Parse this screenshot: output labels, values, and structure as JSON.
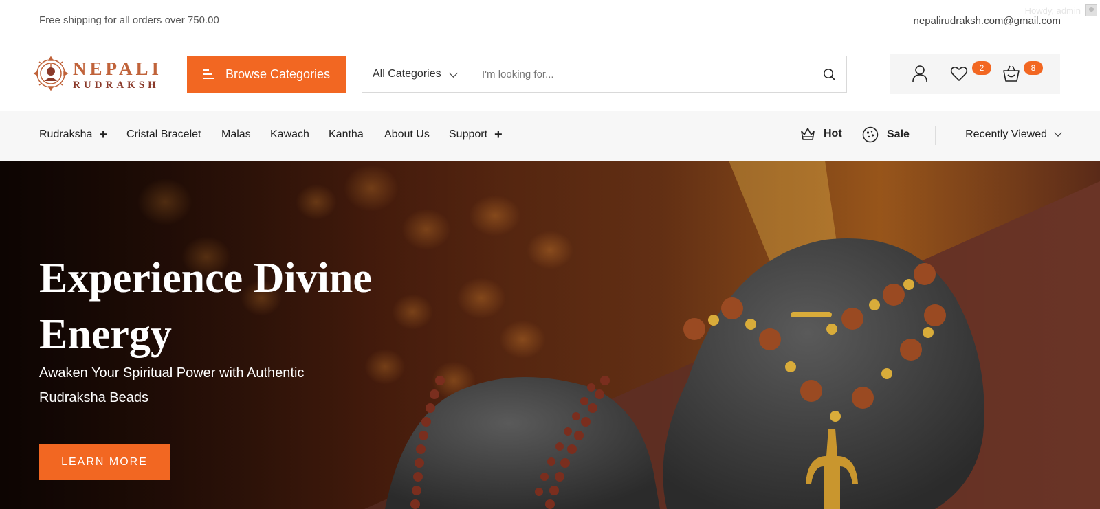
{
  "topbar": {
    "shipping": "Free shipping for all orders over 750.00",
    "email": "nepalirudraksh.com@gmail.com",
    "howdy": "Howdy, admin"
  },
  "header": {
    "logo_line1": "NEPALI",
    "logo_line2": "RUDRAKSH",
    "browse_label": "Browse Categories",
    "search_category": "All Categories",
    "search_placeholder": "I'm looking for...",
    "wishlist_count": "2",
    "cart_count": "8"
  },
  "nav": {
    "items": [
      {
        "label": "Rudraksha",
        "has_submenu": true
      },
      {
        "label": "Cristal Bracelet"
      },
      {
        "label": "Malas"
      },
      {
        "label": "Kawach"
      },
      {
        "label": "Kantha"
      },
      {
        "label": "About Us"
      },
      {
        "label": "Support",
        "has_submenu": true
      }
    ],
    "hot_label": "Hot",
    "sale_label": "Sale",
    "recently_viewed": "Recently Viewed"
  },
  "hero": {
    "title": "Experience Divine Energy",
    "subtitle": "Awaken Your Spiritual Power with Authentic Rudraksha Beads",
    "cta": "LEARN MORE"
  },
  "colors": {
    "accent": "#f26722",
    "logo_primary": "#c0633a",
    "logo_secondary": "#8a3a2a",
    "nav_bg": "#f7f7f7"
  },
  "icons": [
    "menu-icon",
    "chevron-down-icon",
    "search-icon",
    "user-icon",
    "heart-icon",
    "basket-icon",
    "crown-icon",
    "sale-icon",
    "plus-icon",
    "avatar-icon"
  ]
}
